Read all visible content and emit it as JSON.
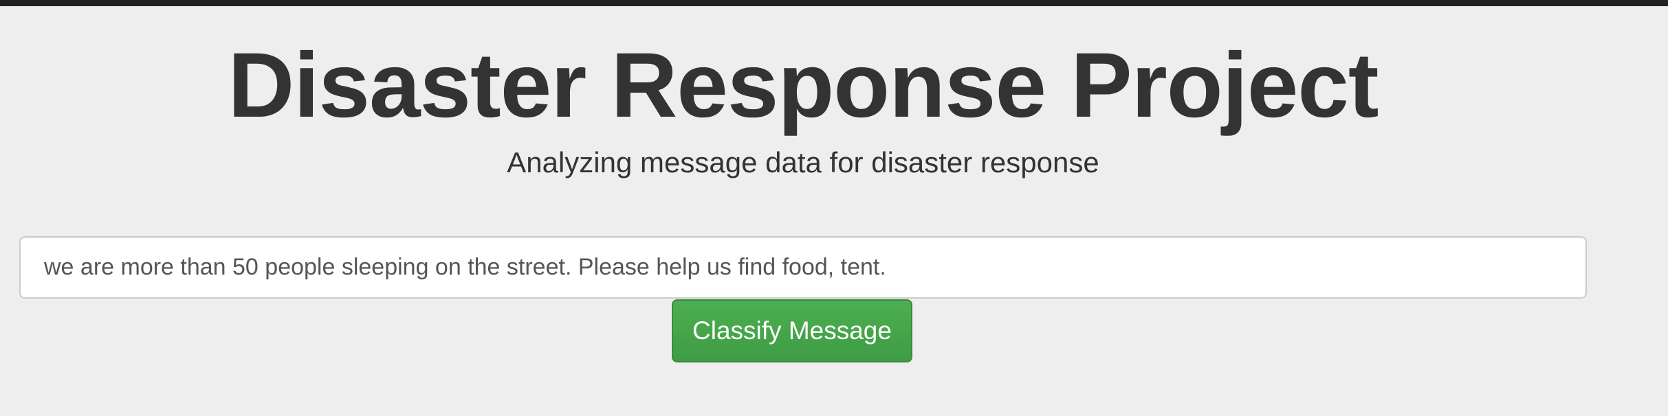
{
  "header": {
    "title": "Disaster Response Project",
    "subtitle": "Analyzing message data for disaster response"
  },
  "form": {
    "query_value": "we are more than 50 people sleeping on the street. Please help us find food, tent.",
    "submit_label": "Classify Message"
  },
  "colors": {
    "navbar": "#222222",
    "background": "#eeeeee",
    "button_green": "#449d44",
    "text": "#333333"
  }
}
